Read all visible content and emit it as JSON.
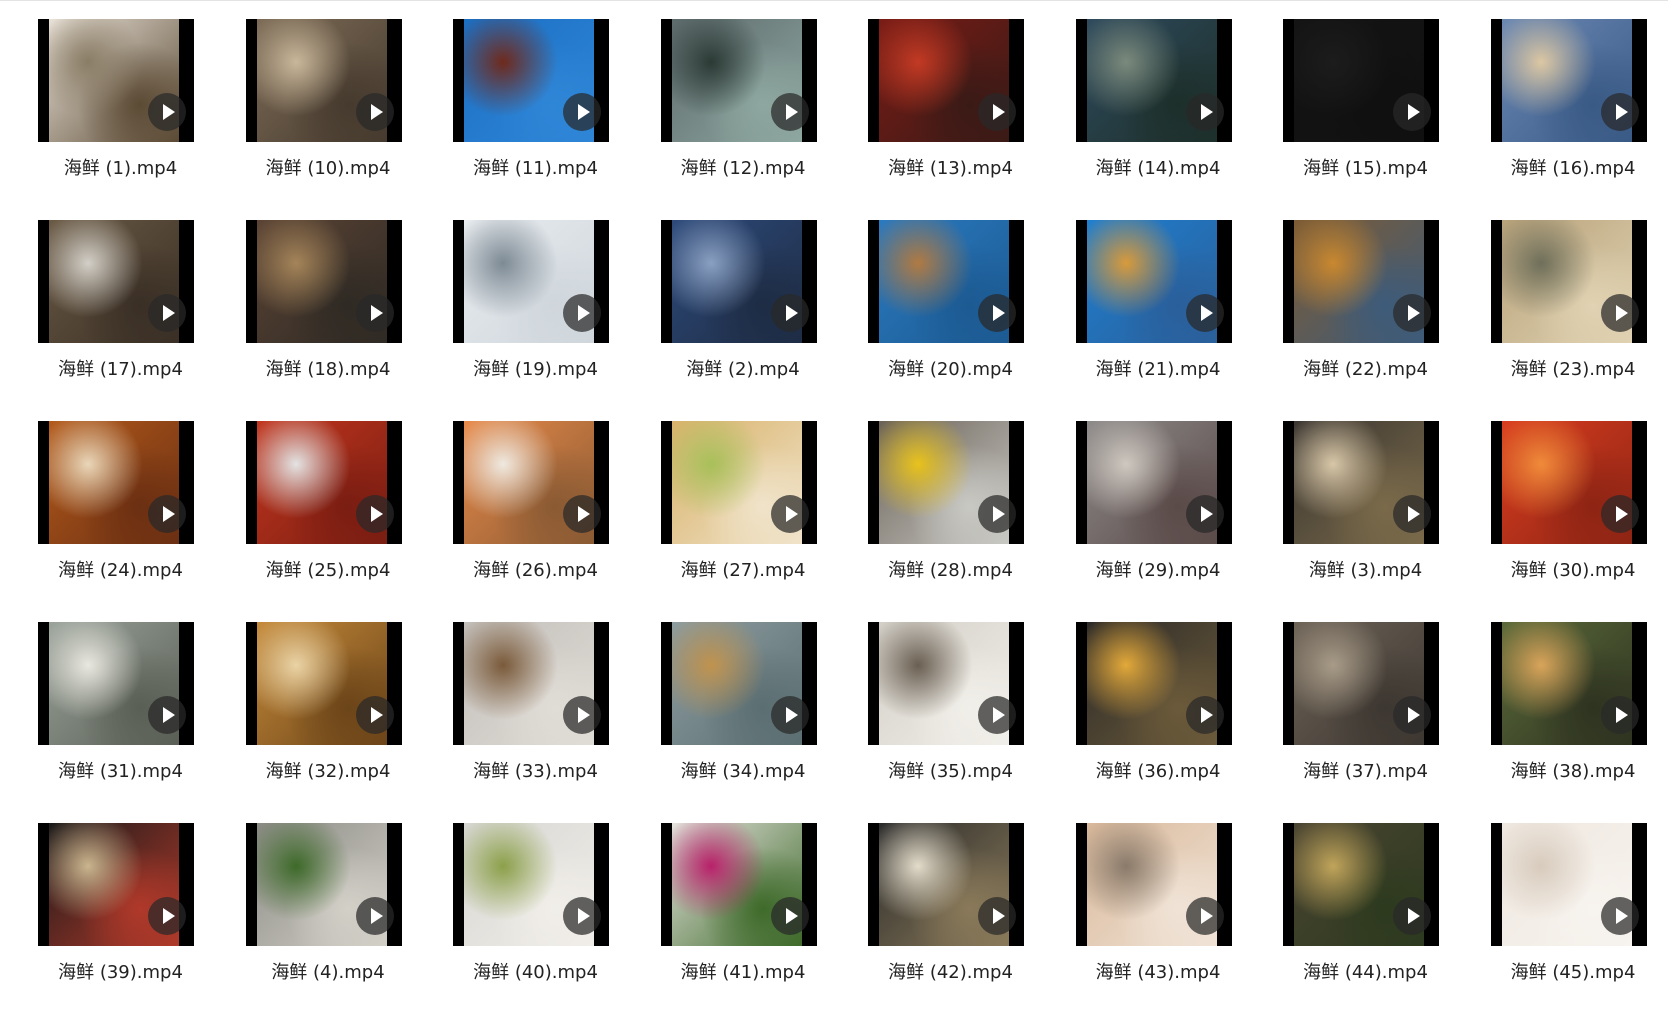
{
  "files": [
    {
      "name": "海鲜 (1).mp4",
      "colors": [
        "#e9e2d8",
        "#8a7d66",
        "#5b4a34"
      ]
    },
    {
      "name": "海鲜 (10).mp4",
      "colors": [
        "#7d6c57",
        "#c9b79a",
        "#463a2e"
      ]
    },
    {
      "name": "海鲜 (11).mp4",
      "colors": [
        "#1b6fc3",
        "#6f2a1c",
        "#2f86d7"
      ]
    },
    {
      "name": "海鲜 (12).mp4",
      "colors": [
        "#5e6b6d",
        "#2b3a35",
        "#8ea7a0"
      ]
    },
    {
      "name": "海鲜 (13).mp4",
      "colors": [
        "#7a1c16",
        "#c23a24",
        "#3a1a16"
      ]
    },
    {
      "name": "海鲜 (14).mp4",
      "colors": [
        "#2e4a5d",
        "#7b8a7c",
        "#1d2f2a"
      ]
    },
    {
      "name": "海鲜 (15).mp4",
      "colors": [
        "#141414",
        "#1c1c1c",
        "#101010"
      ]
    },
    {
      "name": "海鲜 (16).mp4",
      "colors": [
        "#6b88b3",
        "#dcc7a3",
        "#3a5a86"
      ]
    },
    {
      "name": "海鲜 (17).mp4",
      "colors": [
        "#6a5a45",
        "#d3cfc7",
        "#3a2f25"
      ]
    },
    {
      "name": "海鲜 (18).mp4",
      "colors": [
        "#5a4334",
        "#a48459",
        "#2f2a24"
      ]
    },
    {
      "name": "海鲜 (19).mp4",
      "colors": [
        "#e8ecef",
        "#7d8a94",
        "#cfd6dc"
      ]
    },
    {
      "name": "海鲜 (2).mp4",
      "colors": [
        "#2d4a7a",
        "#8aa0c2",
        "#1e2c44"
      ]
    },
    {
      "name": "海鲜 (20).mp4",
      "colors": [
        "#2a7ac0",
        "#b07a42",
        "#1c5a92"
      ]
    },
    {
      "name": "海鲜 (21).mp4",
      "colors": [
        "#1f7fd0",
        "#d89a3b",
        "#2a5f9a"
      ]
    },
    {
      "name": "海鲜 (22).mp4",
      "colors": [
        "#7d5b34",
        "#c9882f",
        "#3d5b7a"
      ]
    },
    {
      "name": "海鲜 (23).mp4",
      "colors": [
        "#b8a27a",
        "#6f6f5a",
        "#e0d2b2"
      ]
    },
    {
      "name": "海鲜 (24).mp4",
      "colors": [
        "#b35a1b",
        "#e9d6b8",
        "#6b2f12"
      ]
    },
    {
      "name": "海鲜 (25).mp4",
      "colors": [
        "#c2361e",
        "#e3e3e3",
        "#7a1d12"
      ]
    },
    {
      "name": "海鲜 (26).mp4",
      "colors": [
        "#e88a4a",
        "#efe9e0",
        "#8a5a33"
      ]
    },
    {
      "name": "海鲜 (27).mp4",
      "colors": [
        "#d9b26a",
        "#a8c05a",
        "#f0e3c9"
      ]
    },
    {
      "name": "海鲜 (28).mp4",
      "colors": [
        "#6a6157",
        "#e8c21c",
        "#c9c9c4"
      ]
    },
    {
      "name": "海鲜 (29).mp4",
      "colors": [
        "#8d8a8a",
        "#cfc8c0",
        "#5a4a48"
      ]
    },
    {
      "name": "海鲜 (3).mp4",
      "colors": [
        "#3b3631",
        "#d8c7a8",
        "#7a6a4a"
      ]
    },
    {
      "name": "海鲜 (30).mp4",
      "colors": [
        "#d93d1f",
        "#f08b3a",
        "#8e2414"
      ]
    },
    {
      "name": "海鲜 (31).mp4",
      "colors": [
        "#9aa39a",
        "#e9e7df",
        "#5a5f55"
      ]
    },
    {
      "name": "海鲜 (32).mp4",
      "colors": [
        "#c58a3a",
        "#ead3a5",
        "#6b4418"
      ]
    },
    {
      "name": "海鲜 (33).mp4",
      "colors": [
        "#c2beb9",
        "#7a5a3a",
        "#e0dcd6"
      ]
    },
    {
      "name": "海鲜 (34).mp4",
      "colors": [
        "#8e9da0",
        "#c0934e",
        "#5b6e72"
      ]
    },
    {
      "name": "海鲜 (35).mp4",
      "colors": [
        "#d3cfc7",
        "#6a5f52",
        "#f1efe9"
      ]
    },
    {
      "name": "海鲜 (36).mp4",
      "colors": [
        "#2c2a28",
        "#e3a93a",
        "#6b5a3a"
      ]
    },
    {
      "name": "海鲜 (37).mp4",
      "colors": [
        "#6d6357",
        "#a89b88",
        "#3d3731"
      ]
    },
    {
      "name": "海鲜 (38).mp4",
      "colors": [
        "#5b6a3a",
        "#d9a45a",
        "#2e3320"
      ]
    },
    {
      "name": "海鲜 (39).mp4",
      "colors": [
        "#1a1a1a",
        "#c9b58e",
        "#b0392a"
      ]
    },
    {
      "name": "海鲜 (4).mp4",
      "colors": [
        "#8a8a84",
        "#3e6a2a",
        "#d3d0c8"
      ]
    },
    {
      "name": "海鲜 (40).mp4",
      "colors": [
        "#d6d6d2",
        "#8ca04a",
        "#f1eee9"
      ]
    },
    {
      "name": "海鲜 (41).mp4",
      "colors": [
        "#e5e3de",
        "#b8216a",
        "#3e6a2a"
      ]
    },
    {
      "name": "海鲜 (42).mp4",
      "colors": [
        "#2a2a2a",
        "#e3dccb",
        "#8a7a5a"
      ]
    },
    {
      "name": "海鲜 (43).mp4",
      "colors": [
        "#d9b89a",
        "#8a7a6a",
        "#f0e3d6"
      ]
    },
    {
      "name": "海鲜 (44).mp4",
      "colors": [
        "#4a4432",
        "#c0a45a",
        "#2d3a1e"
      ]
    },
    {
      "name": "海鲜 (45).mp4",
      "colors": [
        "#efe8e0",
        "#d8cbbd",
        "#f7f3ee"
      ]
    }
  ]
}
